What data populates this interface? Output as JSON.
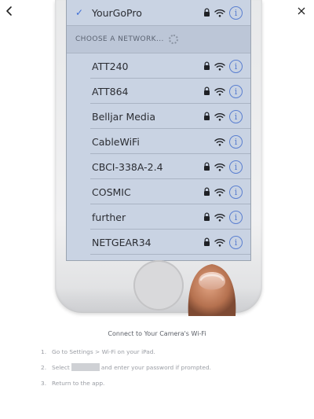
{
  "network_list": {
    "connected": {
      "name": "YourGoPro",
      "selected": true
    },
    "section_header": "CHOOSE A NETWORK...",
    "networks": [
      {
        "name": "ATT240",
        "locked": true
      },
      {
        "name": "ATT864",
        "locked": true
      },
      {
        "name": "Belljar Media",
        "locked": true
      },
      {
        "name": "CableWiFi",
        "locked": false
      },
      {
        "name": "CBCI-338A-2.4",
        "locked": true
      },
      {
        "name": "COSMIC",
        "locked": true
      },
      {
        "name": "further",
        "locked": true
      },
      {
        "name": "NETGEAR34",
        "locked": true
      }
    ]
  },
  "icons": {
    "back": "chevron-left-icon",
    "close": "close-icon",
    "wifi": "wifi-icon",
    "lock": "lock-icon",
    "info": "info-icon",
    "check": "checkmark-icon",
    "spinner": "loading-spinner-icon"
  },
  "instructions": {
    "title": "Connect to Your Camera's Wi-Fi",
    "steps": [
      {
        "num": "1.",
        "text": "Go to Settings > Wi-Fi on your iPad."
      },
      {
        "num": "2.",
        "pre": "Select",
        "post": "and enter your password if prompted."
      },
      {
        "num": "3.",
        "text": "Return to the app."
      }
    ]
  },
  "colors": {
    "screen_background": "#c9d3e3",
    "accent": "#5a7fd0",
    "text_muted": "#9a9da4"
  }
}
